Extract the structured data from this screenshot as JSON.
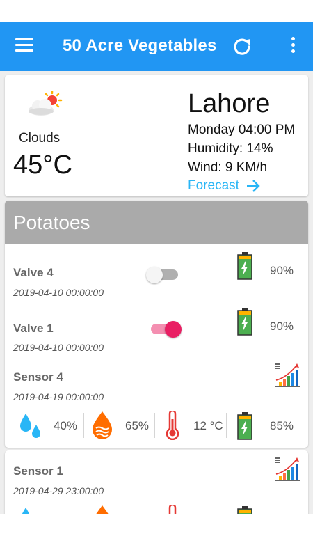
{
  "appbar": {
    "title": "50 Acre Vegetables",
    "menu_icon": "hamburger-menu-icon",
    "refresh_icon": "refresh-icon",
    "more_icon": "more-vert-icon",
    "color": "#2196f3"
  },
  "weather": {
    "icon": "cloud-sun-icon",
    "condition": "Clouds",
    "temperature": "45°C",
    "city": "Lahore",
    "datetime": "Monday 04:00 PM",
    "humidity": "Humidity: 14%",
    "wind": "Wind: 9 KM/h",
    "forecast_label": "Forecast",
    "forecast_color": "#29b6f6"
  },
  "group": {
    "title": "Potatoes",
    "valves": [
      {
        "name": "Valve 4",
        "date": "2019-04-10 00:00:00",
        "on": false,
        "battery": "90%"
      },
      {
        "name": "Valve 1",
        "date": "2019-04-10 00:00:00",
        "on": true,
        "battery": "90%"
      }
    ],
    "sensors": [
      {
        "name": "Sensor 4",
        "date": "2019-04-19 00:00:00",
        "water": "40%",
        "moisture": "65%",
        "temperature": "12 °C",
        "battery": "85%"
      }
    ]
  },
  "sensor_card": {
    "name": "Sensor 1",
    "date": "2019-04-29 23:00:00"
  },
  "colors": {
    "toggle_on": "#e91e63",
    "toggle_off_track": "#b0b0b0",
    "battery_green": "#4caf50",
    "drop_blue": "#29b6f6",
    "drop_orange": "#ff6d00",
    "thermo_red": "#e53935"
  }
}
